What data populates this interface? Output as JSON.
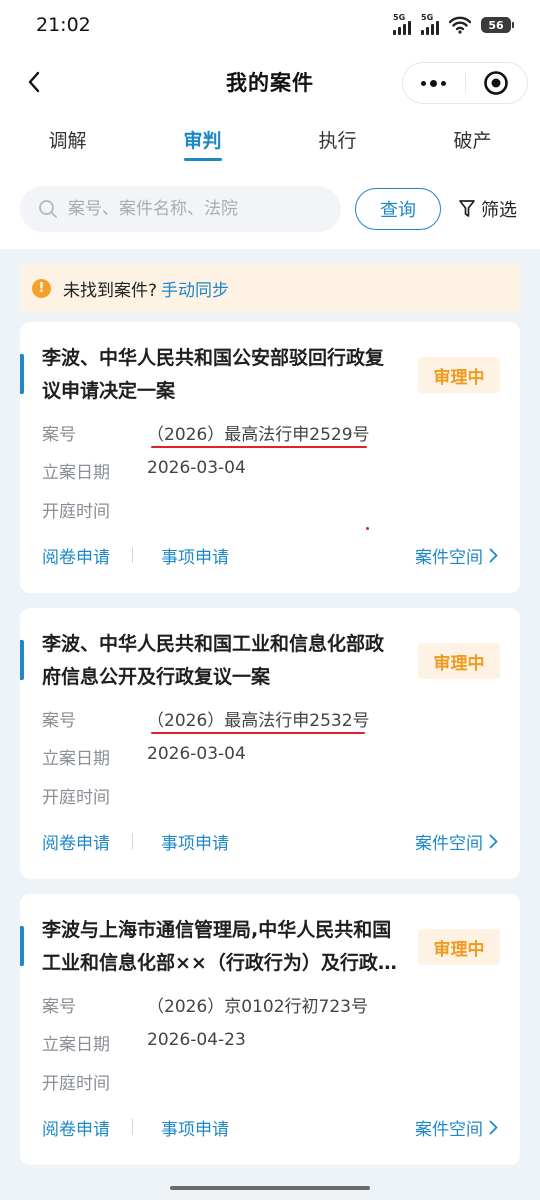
{
  "status_bar": {
    "time": "21:02",
    "sim1": "5G",
    "sim2": "5G",
    "battery": "56"
  },
  "nav": {
    "title": "我的案件",
    "back_icon": "chevron-left-icon",
    "more_icon": "more-dots-icon",
    "target_icon": "target-icon"
  },
  "tabs": [
    {
      "label": "调解",
      "active": false
    },
    {
      "label": "审判",
      "active": true
    },
    {
      "label": "执行",
      "active": false
    },
    {
      "label": "破产",
      "active": false
    }
  ],
  "search": {
    "placeholder": "案号、案件名称、法院",
    "query_label": "查询",
    "filter_label": "筛选"
  },
  "notice": {
    "text": "未找到案件?",
    "link": "手动同步"
  },
  "field_labels": {
    "case_no": "案号",
    "filing_date": "立案日期",
    "hearing_time": "开庭时间"
  },
  "cards": [
    {
      "title": "李波、中华人民共和国公安部驳回行政复议申请决定一案",
      "status": "审理中",
      "case_no": "（2026）最高法行申2529号",
      "filing_date": "2026-03-04",
      "hearing_time": "",
      "action1": "阅卷申请",
      "action2": "事项申请",
      "action3": "案件空间"
    },
    {
      "title": "李波、中华人民共和国工业和信息化部政府信息公开及行政复议一案",
      "status": "审理中",
      "case_no": "（2026）最高法行申2532号",
      "filing_date": "2026-03-04",
      "hearing_time": "",
      "action1": "阅卷申请",
      "action2": "事项申请",
      "action3": "案件空间"
    },
    {
      "title": "李波与上海市通信管理局,中华人民共和国工业和信息化部××（行政行为）及行政复议一案",
      "status": "审理中",
      "case_no": "（2026）京0102行初723号",
      "filing_date": "2026-04-23",
      "hearing_time": "",
      "action1": "阅卷申请",
      "action2": "事项申请",
      "action3": "案件空间"
    }
  ],
  "colors": {
    "accent": "#1e88c8",
    "status": "#f29a1e",
    "status_bg": "#fdf2e4",
    "annotation": "#e0202a"
  }
}
